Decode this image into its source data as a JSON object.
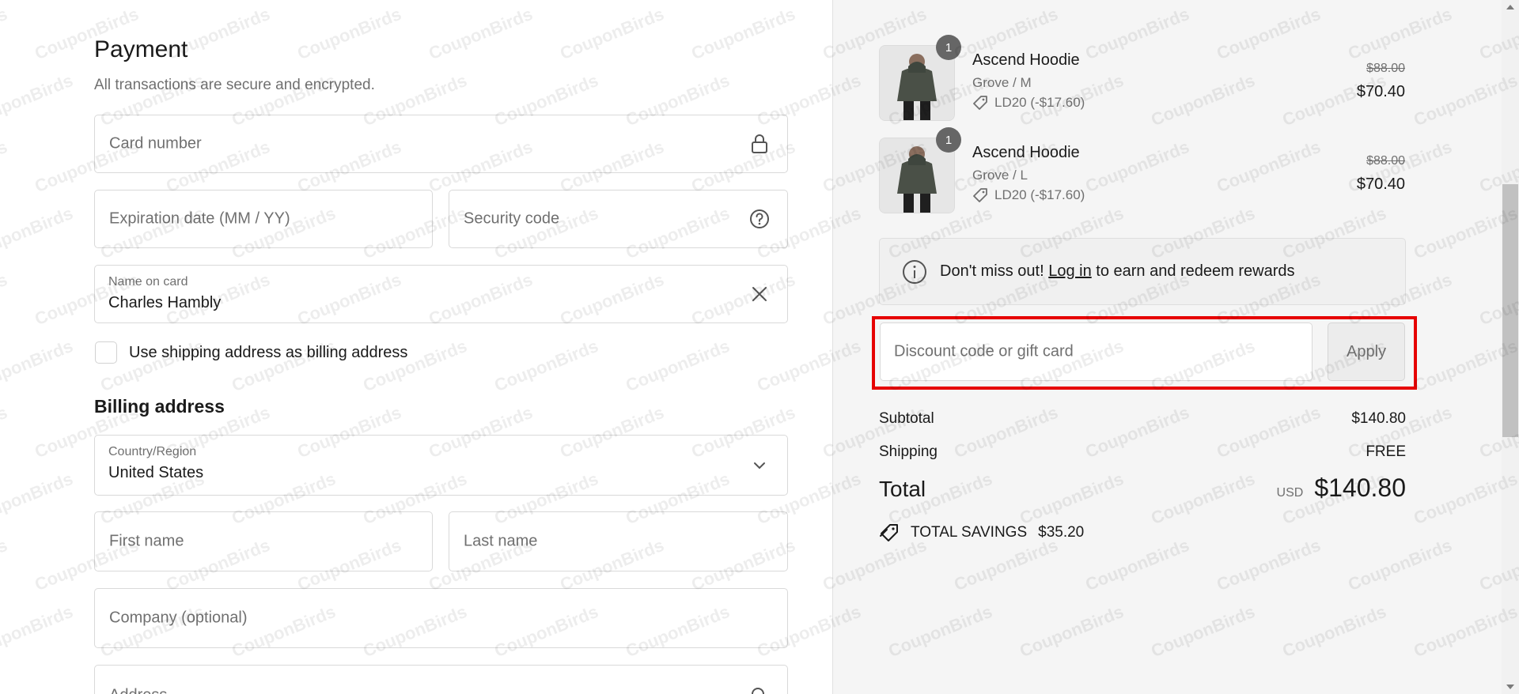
{
  "payment": {
    "title": "Payment",
    "subtitle": "All transactions are secure and encrypted.",
    "card_number_placeholder": "Card number",
    "expiration_placeholder": "Expiration date (MM / YY)",
    "security_code_placeholder": "Security code",
    "name_on_card_label": "Name on card",
    "name_on_card_value": "Charles Hambly",
    "use_shipping_label": "Use shipping address as billing address"
  },
  "billing": {
    "title": "Billing address",
    "country_label": "Country/Region",
    "country_value": "United States",
    "first_name_placeholder": "First name",
    "last_name_placeholder": "Last name",
    "company_placeholder": "Company (optional)",
    "address_placeholder": "Address"
  },
  "order": {
    "items": [
      {
        "quantity": "1",
        "name": "Ascend Hoodie",
        "variant": "Grove / M",
        "discount": "LD20 (-$17.60)",
        "original_price": "$88.00",
        "price": "$70.40"
      },
      {
        "quantity": "1",
        "name": "Ascend Hoodie",
        "variant": "Grove / L",
        "discount": "LD20 (-$17.60)",
        "original_price": "$88.00",
        "price": "$70.40"
      }
    ],
    "notice": {
      "prefix": "Don't miss out!",
      "link": "Log in",
      "suffix": "to earn and redeem rewards"
    },
    "discount_placeholder": "Discount code or gift card",
    "apply_label": "Apply",
    "subtotal_label": "Subtotal",
    "subtotal_value": "$140.80",
    "shipping_label": "Shipping",
    "shipping_value": "FREE",
    "total_label": "Total",
    "currency": "USD",
    "total_value": "$140.80",
    "savings_label": "TOTAL SAVINGS",
    "savings_value": "$35.20"
  },
  "watermark_text": "CouponBirds",
  "colors": {
    "highlight": "#e60000",
    "right_bg": "#f5f5f5",
    "muted_text": "#707070",
    "hoodie": "#4a5047"
  }
}
